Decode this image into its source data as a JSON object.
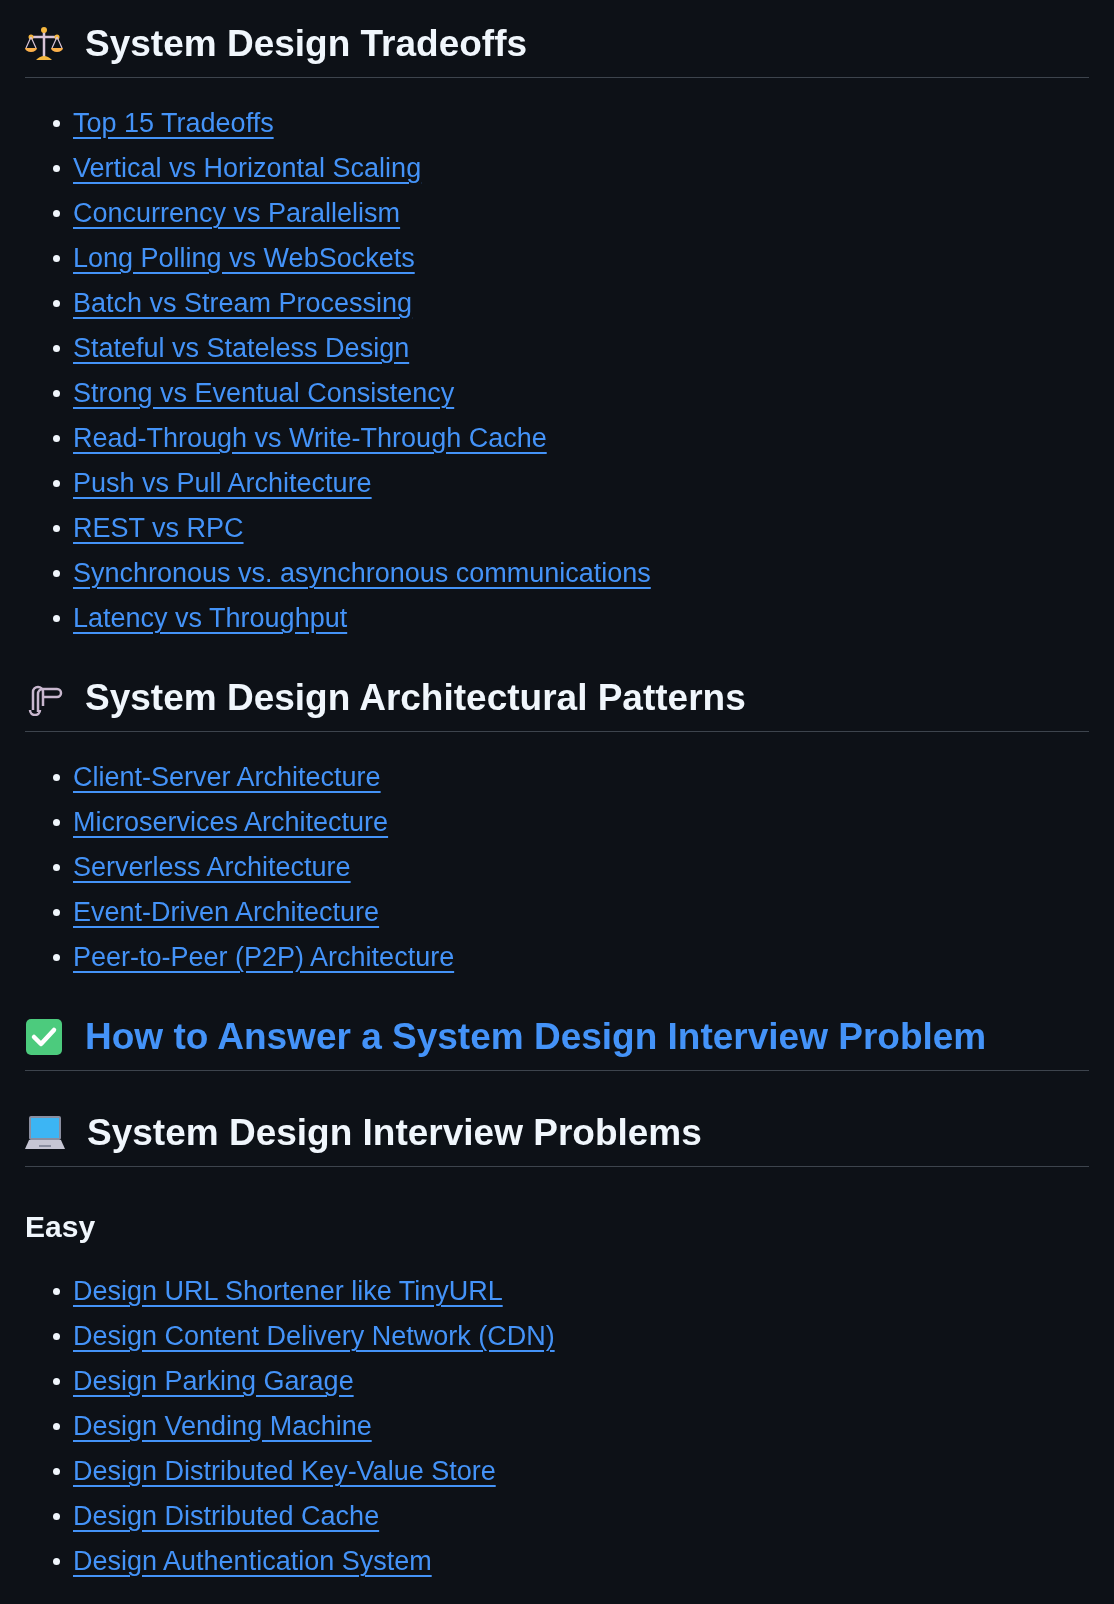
{
  "sections": [
    {
      "heading": {
        "text": "System Design Tradeoffs",
        "is_link": false
      },
      "links": [
        "Top 15 Tradeoffs",
        "Vertical vs Horizontal Scaling",
        "Concurrency vs Parallelism",
        "Long Polling vs WebSockets",
        "Batch vs Stream Processing",
        "Stateful vs Stateless Design",
        "Strong vs Eventual Consistency",
        "Read-Through vs Write-Through Cache",
        "Push vs Pull Architecture",
        "REST vs RPC",
        "Synchronous vs. asynchronous communications",
        "Latency vs Throughput"
      ]
    },
    {
      "heading": {
        "text": "System Design Architectural Patterns",
        "is_link": false
      },
      "links": [
        "Client-Server Architecture",
        "Microservices Architecture",
        "Serverless Architecture",
        "Event-Driven Architecture",
        "Peer-to-Peer (P2P) Architecture"
      ]
    },
    {
      "heading": {
        "text": "How to Answer a System Design Interview Problem",
        "is_link": true
      }
    },
    {
      "heading": {
        "text": "System Design Interview Problems",
        "is_link": false
      },
      "subheading": "Easy",
      "links": [
        "Design URL Shortener like TinyURL",
        "Design Content Delivery Network (CDN)",
        "Design Parking Garage",
        "Design Vending Machine",
        "Design Distributed Key-Value Store",
        "Design Distributed Cache",
        "Design Authentication System"
      ]
    }
  ]
}
